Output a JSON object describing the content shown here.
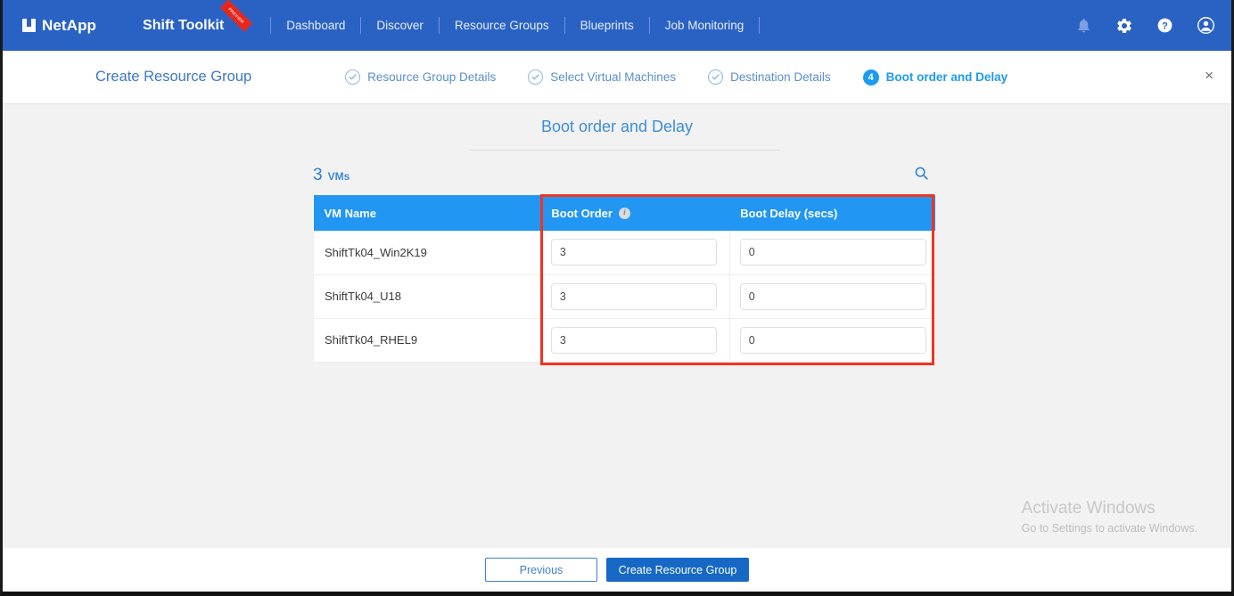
{
  "topbar": {
    "brand": "NetApp",
    "product": "Shift Toolkit",
    "preview_badge": "PREVIEW",
    "nav": [
      {
        "label": "Dashboard"
      },
      {
        "label": "Discover"
      },
      {
        "label": "Resource Groups"
      },
      {
        "label": "Blueprints"
      },
      {
        "label": "Job Monitoring"
      }
    ],
    "icons": [
      {
        "name": "notification-bell-icon"
      },
      {
        "name": "settings-gear-icon"
      },
      {
        "name": "help-question-icon"
      },
      {
        "name": "user-account-icon"
      }
    ],
    "background": "#2a62c4"
  },
  "wizard": {
    "title": "Create Resource Group",
    "close_label": "×",
    "steps": [
      {
        "label": "Resource Group Details",
        "state": "done",
        "marker": "✓"
      },
      {
        "label": "Select Virtual Machines",
        "state": "done",
        "marker": "✓"
      },
      {
        "label": "Destination Details",
        "state": "done",
        "marker": "✓"
      },
      {
        "label": "Boot order and Delay",
        "state": "active",
        "marker": "4"
      }
    ],
    "active_color": "#1c9bf0",
    "done_color": "#5b8fc9"
  },
  "main": {
    "heading": "Boot order and Delay",
    "count_number": "3",
    "count_unit": "VMs",
    "search_icon": "search-icon",
    "table": {
      "columns": [
        {
          "label": "VM Name",
          "info": false
        },
        {
          "label": "Boot Order",
          "info": true
        },
        {
          "label": "Boot Delay (secs)",
          "info": false
        }
      ],
      "info_glyph": "i",
      "header_background": "#2196f3",
      "rows": [
        {
          "vm_name": "ShiftTk04_Win2K19",
          "boot_order": "3",
          "boot_delay": "0"
        },
        {
          "vm_name": "ShiftTk04_U18",
          "boot_order": "3",
          "boot_delay": "0"
        },
        {
          "vm_name": "ShiftTk04_RHEL9",
          "boot_order": "3",
          "boot_delay": "0"
        }
      ]
    },
    "annotation_color": "#f4321f"
  },
  "watermark": {
    "title": "Activate Windows",
    "subtitle": "Go to Settings to activate Windows."
  },
  "footer": {
    "previous_label": "Previous",
    "create_label": "Create Resource Group",
    "primary_color": "#1668c4"
  }
}
